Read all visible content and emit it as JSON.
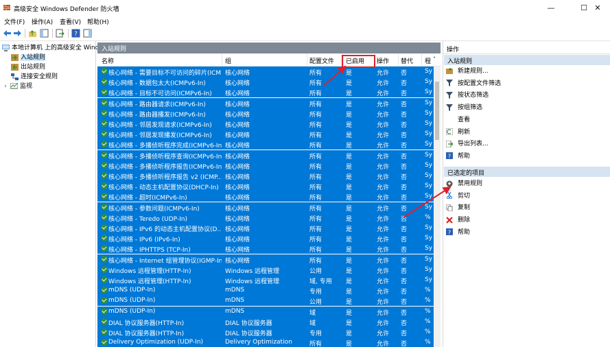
{
  "window": {
    "title": "高级安全 Windows Defender 防火墙",
    "controls": [
      "—",
      "☐",
      "✕"
    ]
  },
  "menu": [
    "文件(F)",
    "操作(A)",
    "查看(V)",
    "帮助(H)"
  ],
  "tree": {
    "root": "本地计算机 上的高级安全 Wind",
    "items": [
      {
        "label": "入站规则",
        "selected": true
      },
      {
        "label": "出站规则",
        "selected": false
      },
      {
        "label": "连接安全规则",
        "selected": false
      },
      {
        "label": "监视",
        "selected": false
      }
    ]
  },
  "pane": {
    "title": "入站规则",
    "columns": [
      "名称",
      "组",
      "配置文件",
      "已启用",
      "操作",
      "替代",
      "程"
    ],
    "rows": [
      [
        "核心网络 - 需要目标不可访问的碎片(ICMP...",
        "核心网络",
        "所有",
        "是",
        "允许",
        "否",
        "Sy"
      ],
      [
        "核心网络 - 数据包太大(ICMPv6-In)",
        "核心网络",
        "所有",
        "是",
        "允许",
        "否",
        "Sy"
      ],
      [
        "核心网络 - 目标不可访问(ICMPv6-In)",
        "核心网络",
        "所有",
        "是",
        "允许",
        "否",
        "Sy"
      ],
      [
        "核心网络 - 路由器请求(ICMPv6-In)",
        "核心网络",
        "所有",
        "是",
        "允许",
        "否",
        "Sy"
      ],
      [
        "核心网络 - 路由器播发(ICMPv6-In)",
        "核心网络",
        "所有",
        "是",
        "允许",
        "否",
        "Sy"
      ],
      [
        "核心网络 - 邻居发现请求(ICMPv6-In)",
        "核心网络",
        "所有",
        "是",
        "允许",
        "否",
        "Sy"
      ],
      [
        "核心网络 - 邻居发现播发(ICMPv6-In)",
        "核心网络",
        "所有",
        "是",
        "允许",
        "否",
        "Sy"
      ],
      [
        "核心网络 - 多播侦听程序完成(ICMPv6-In)",
        "核心网络",
        "所有",
        "是",
        "允许",
        "否",
        "Sy"
      ],
      [
        "核心网络 - 多播侦听程序查询(ICMPv6-In)",
        "核心网络",
        "所有",
        "是",
        "允许",
        "否",
        "Sy"
      ],
      [
        "核心网络 - 多播侦听程序报告(ICMPv6-In)",
        "核心网络",
        "所有",
        "是",
        "允许",
        "否",
        "Sy"
      ],
      [
        "核心网络 - 多播侦听程序报告 v2 (ICMP...",
        "核心网络",
        "所有",
        "是",
        "允许",
        "否",
        "Sy"
      ],
      [
        "核心网络 - 动态主机配置协议(DHCP-In)",
        "核心网络",
        "所有",
        "是",
        "允许",
        "否",
        "Sy"
      ],
      [
        "核心网络 - 超时(ICMPv6-In)",
        "核心网络",
        "所有",
        "是",
        "允许",
        "否",
        "Sy"
      ],
      [
        "核心网络 - 参数问题(ICMPv6-In)",
        "核心网络",
        "所有",
        "是",
        "允许",
        "否",
        "Sy"
      ],
      [
        "核心网络 - Teredo (UDP-In)",
        "核心网络",
        "所有",
        "是",
        "允许",
        "否",
        "%"
      ],
      [
        "核心网络 - IPv6 的动态主机配置协议(D...",
        "核心网络",
        "所有",
        "是",
        "允许",
        "否",
        "Sy"
      ],
      [
        "核心网络 - IPv6 (IPv6-In)",
        "核心网络",
        "所有",
        "是",
        "允许",
        "否",
        "Sy"
      ],
      [
        "核心网络 - IPHTTPS (TCP-In)",
        "核心网络",
        "所有",
        "是",
        "允许",
        "否",
        "Sy"
      ],
      [
        "核心网络 - Internet 组管理协议(IGMP-In)",
        "核心网络",
        "所有",
        "是",
        "允许",
        "否",
        "Sy"
      ],
      [
        "Windows 远程管理(HTTP-In)",
        "Windows 远程管理",
        "公用",
        "是",
        "允许",
        "否",
        "Sy"
      ],
      [
        "Windows 远程管理(HTTP-In)",
        "Windows 远程管理",
        "域, 专用",
        "是",
        "允许",
        "否",
        "Sy"
      ],
      [
        "mDNS (UDP-In)",
        "mDNS",
        "专用",
        "是",
        "允许",
        "否",
        "%"
      ],
      [
        "mDNS (UDP-In)",
        "mDNS",
        "公用",
        "是",
        "允许",
        "否",
        "%"
      ],
      [
        "mDNS (UDP-In)",
        "mDNS",
        "域",
        "是",
        "允许",
        "否",
        "%"
      ],
      [
        "DIAL 协议服务器(HTTP-In)",
        "DIAL 协议服务器",
        "域",
        "是",
        "允许",
        "否",
        "%"
      ],
      [
        "DIAL 协议服务器(HTTP-In)",
        "DIAL 协议服务器",
        "专用",
        "是",
        "允许",
        "否",
        "%"
      ],
      [
        "Delivery Optimization (UDP-In)",
        "Delivery Optimization",
        "所有",
        "是",
        "允许",
        "否",
        "%"
      ]
    ]
  },
  "actions": {
    "title": "操作",
    "section1": "入站规则",
    "items1": [
      {
        "label": "新建规则...",
        "icon": "new-rule-icon"
      },
      {
        "label": "按配置文件筛选",
        "icon": "filter-icon"
      },
      {
        "label": "按状态筛选",
        "icon": "filter-icon"
      },
      {
        "label": "按组筛选",
        "icon": "filter-icon"
      },
      {
        "label": "查看",
        "icon": ""
      },
      {
        "label": "刷新",
        "icon": "refresh-icon"
      },
      {
        "label": "导出列表...",
        "icon": "export-icon"
      },
      {
        "label": "帮助",
        "icon": "help-icon"
      }
    ],
    "section2": "已选定的项目",
    "items2": [
      {
        "label": "禁用规则",
        "icon": "disable-icon"
      },
      {
        "label": "剪切",
        "icon": "cut-icon"
      },
      {
        "label": "复制",
        "icon": "copy-icon"
      },
      {
        "label": "删除",
        "icon": "delete-icon"
      },
      {
        "label": "帮助",
        "icon": "help-icon"
      }
    ]
  },
  "colors": {
    "selection": "#0078d7",
    "pane_header": "#7d8a96",
    "section_header": "#d6e3f0",
    "annotation": "#e0202a"
  }
}
